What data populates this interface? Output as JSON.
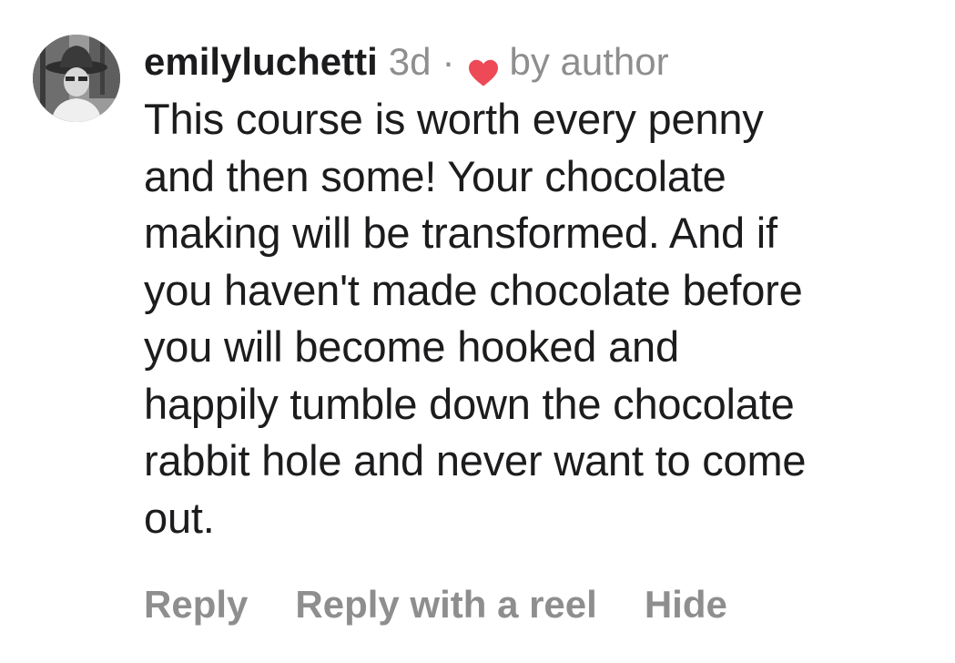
{
  "comment": {
    "avatar": "profile-photo",
    "username": "emilyluchetti",
    "time": "3d",
    "separator": "·",
    "heart_icon": "heart-icon",
    "heart_color": "#ed4956",
    "liked_by": "by author",
    "text_lines": [
      "This course is worth every penny",
      "and then some! Your chocolate",
      "making will be transformed. And if",
      "you haven't made chocolate before",
      "you will become hooked and",
      "happily tumble down the chocolate",
      "rabbit hole and never want to come",
      "out."
    ],
    "actions": {
      "reply": "Reply",
      "reply_with_reel": "Reply with a reel",
      "hide": "Hide"
    }
  }
}
